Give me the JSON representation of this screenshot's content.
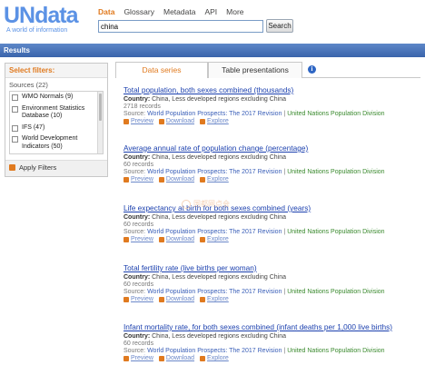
{
  "logo": {
    "text_un": "UN",
    "text_data": "data",
    "tagline": "A world of information"
  },
  "topnav": [
    "Data",
    "Glossary",
    "Metadata",
    "API",
    "More"
  ],
  "search": {
    "value": "china",
    "button_label": "Search"
  },
  "results_bar": "Results",
  "filters": {
    "title": "Select filters:",
    "sources_header": "Sources (22)",
    "items": [
      "WMO Normals (9)",
      "Environment Statistics Database (10)",
      "IFS (47)",
      "World Development Indicators (50)"
    ],
    "apply_label": "Apply Filters"
  },
  "tabs": [
    "Data series",
    "Table presentations"
  ],
  "info_icon_glyph": "i",
  "results": [
    {
      "title": "Total population, both sexes combined (thousands)",
      "country_label": "Country:",
      "country": "China, Less developed regions excluding China",
      "count": "2718 records",
      "source_label": "Source:",
      "source1": "World Population Prospects: The 2017 Revision",
      "source2": "United Nations Population Division",
      "preview": "Preview",
      "download": "Download",
      "explore": "Explore"
    },
    {
      "title": "Average annual rate of population change (percentage)",
      "country_label": "Country:",
      "country": "China, Less developed regions excluding China",
      "count": "60 records",
      "source_label": "Source:",
      "source1": "World Population Prospects: The 2017 Revision",
      "source2": "United Nations Population Division",
      "preview": "Preview",
      "download": "Download",
      "explore": "Explore"
    },
    {
      "title": "Life expectancy at birth for both sexes combined (years)",
      "country_label": "Country:",
      "country": "China, Less developed regions excluding China",
      "count": "60 records",
      "source_label": "Source:",
      "source1": "World Population Prospects: The 2017 Revision",
      "source2": "United Nations Population Division",
      "preview": "Preview",
      "download": "Download",
      "explore": "Explore"
    },
    {
      "title": "Total fertility rate (live births per woman)",
      "country_label": "Country:",
      "country": "China, Less developed regions excluding China",
      "count": "60 records",
      "source_label": "Source:",
      "source1": "World Population Prospects: The 2017 Revision",
      "source2": "United Nations Population Division",
      "preview": "Preview",
      "download": "Download",
      "explore": "Explore"
    },
    {
      "title": "Infant mortality rate, for both sexes combined (infant deaths per 1,000 live births)",
      "country_label": "Country:",
      "country": "China, Less developed regions excluding China",
      "count": "60 records",
      "source_label": "Source:",
      "source1": "World Population Prospects: The 2017 Revision",
      "source2": "United Nations Population Division",
      "preview": "Preview",
      "download": "Download",
      "explore": "Explore"
    }
  ],
  "watermark": "国都网点会",
  "colors": {
    "brand_blue": "#5b92e5",
    "accent_orange": "#e07a1f",
    "link_blue": "#1a3fae",
    "results_bar": "#3a64ab",
    "source_green": "#3a8a2e"
  }
}
